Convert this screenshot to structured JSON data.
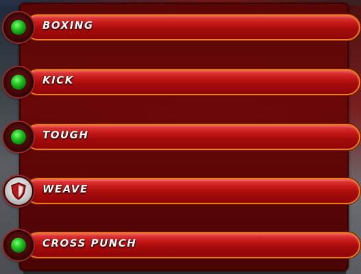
{
  "skills": [
    {
      "label": "BOXING",
      "status_icon": "green-dot-icon",
      "status_color": "#22c822"
    },
    {
      "label": "KICK",
      "status_icon": "green-dot-icon",
      "status_color": "#22c822"
    },
    {
      "label": "TOUGH",
      "status_icon": "green-dot-icon",
      "status_color": "#22c822"
    },
    {
      "label": "WEAVE",
      "status_icon": "shield-icon",
      "status_color": "#c8c8c8"
    },
    {
      "label": "CROSS PUNCH",
      "status_icon": "green-dot-icon",
      "status_color": "#22c822"
    }
  ],
  "colors": {
    "panel": "#5a0606",
    "bar": "#c81a1a",
    "bar_border": "#f07a18",
    "label": "#ffffff"
  }
}
